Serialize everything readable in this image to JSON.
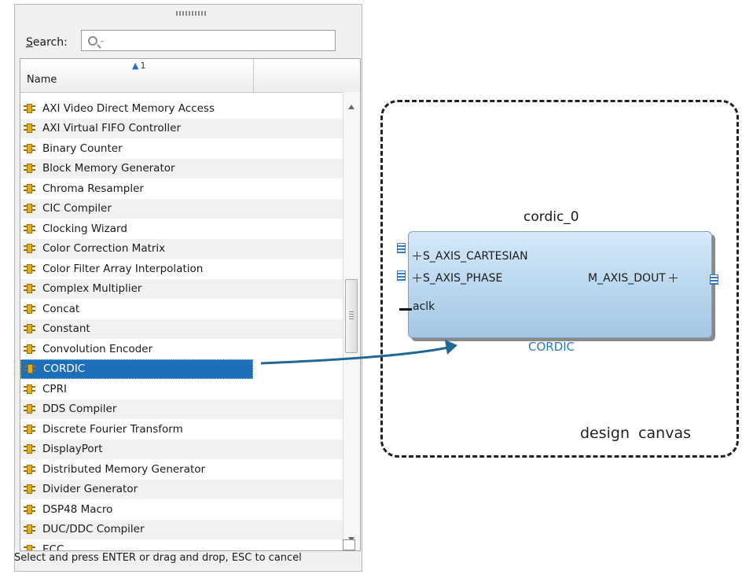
{
  "search": {
    "label_accel": "S",
    "label_rest": "earch:",
    "value": ""
  },
  "table": {
    "column_header": "Name",
    "sort_indicator": "1"
  },
  "ip_list": [
    "AXI Video Direct Memory Access",
    "AXI Virtual FIFO Controller",
    "Binary Counter",
    "Block Memory Generator",
    "Chroma Resampler",
    "CIC Compiler",
    "Clocking Wizard",
    "Color Correction Matrix",
    "Color Filter Array Interpolation",
    "Complex Multiplier",
    "Concat",
    "Constant",
    "Convolution Encoder",
    "CORDIC",
    "CPRI",
    "DDS Compiler",
    "Discrete Fourier Transform",
    "DisplayPort",
    "Distributed Memory Generator",
    "Divider Generator",
    "DSP48 Macro",
    "DUC/DDC Compiler",
    "ECC"
  ],
  "selected_item": "CORDIC",
  "status_text": "Select and press ENTER or drag and drop, ESC to cancel",
  "canvas": {
    "label": "design canvas",
    "block_instance": "cordic_0",
    "block_type": "CORDIC",
    "ports": {
      "in1": "S_AXIS_CARTESIAN",
      "in2": "S_AXIS_PHASE",
      "clk": "aclk",
      "out": "M_AXIS_DOUT"
    }
  },
  "colors": {
    "selection": "#1f6fb8",
    "accent": "#2d79bd",
    "icon": "#e3ac1c",
    "block_fill": "#b7d6ef"
  }
}
